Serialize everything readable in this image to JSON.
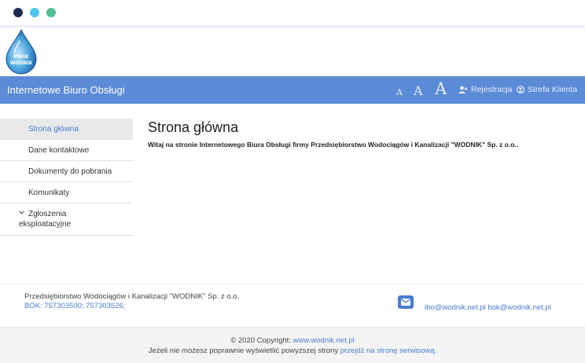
{
  "header": {
    "logo_text_top": "PWiK",
    "logo_text_bottom": "WODNIK",
    "nav_title": "Internetowe Biuro Obsługi",
    "font_small": "A",
    "font_medium": "A",
    "font_large": "A",
    "register_label": "Rejestracja",
    "client_zone_label": "Strefa Klienta"
  },
  "sidebar": {
    "items": [
      {
        "label": "Strona główna",
        "active": true
      },
      {
        "label": "Dane kontaktowe"
      },
      {
        "label": "Dokumenty do pobrania"
      },
      {
        "label": "Komunikaty"
      },
      {
        "label_line1": "Zgłoszenia",
        "label_line2": "eksploatacyjne"
      }
    ]
  },
  "main": {
    "title": "Strona główna",
    "welcome": "Witaj na stronie Internetowego Biura Obsługi firmy Przedsiębiorstwo Wodociągów i Kanalizacji \"WODNIK\" Sp. z o.o.."
  },
  "footer": {
    "company": "Przedsiębiorstwo Wodociągów i Kanalizacji \"WODNIK\" Sp. z o.o.",
    "bok": "BOK: 757303500; 757303526;",
    "emails": "ibo@wodnik.net.pl bok@wodnik.net.pl",
    "copyright_prefix": "© 2020 Copyright: ",
    "copyright_link": "www.wodnik.net.pl",
    "compat_text": "Jeżeli nie możesz poprawnie wyświetlić powyższej strony ",
    "compat_link": "przejdź na stronę serwisową."
  },
  "colors": {
    "navbar": "#5b8ad6",
    "accent": "#4a7bd0",
    "dot1": "#1d2b4f",
    "dot2": "#4ec6ee",
    "dot3": "#4fbf93"
  },
  "icons": [
    "user-plus-icon",
    "user-circle-icon",
    "envelope-icon",
    "chevron-down-icon"
  ]
}
